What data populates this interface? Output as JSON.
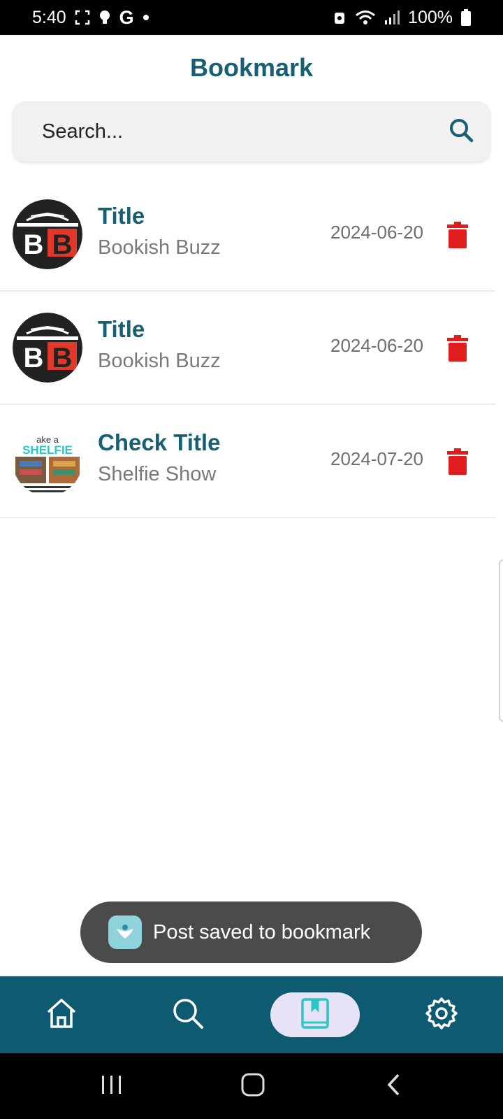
{
  "status_bar": {
    "time": "5:40",
    "icons_left": [
      "screenshot-icon",
      "lightbulb-icon",
      "google-icon",
      "dot-icon"
    ],
    "g_letter": "G",
    "battery": "100%"
  },
  "header": {
    "title": "Bookmark"
  },
  "search": {
    "placeholder": "Search...",
    "value": ""
  },
  "bookmarks": [
    {
      "title": "Title",
      "source": "Bookish Buzz",
      "date": "2024-06-20",
      "avatar": "bookish-buzz-logo",
      "logo_text": "BB"
    },
    {
      "title": "Title",
      "source": "Bookish Buzz",
      "date": "2024-06-20",
      "avatar": "bookish-buzz-logo",
      "logo_text": "BB"
    },
    {
      "title": "Check Title",
      "source": "Shelfie Show",
      "date": "2024-07-20",
      "avatar": "shelfie-show-logo",
      "logo_text": "SHELFIE"
    }
  ],
  "toast": {
    "message": "Post saved to bookmark"
  },
  "nav": {
    "items": [
      "home-icon",
      "search-icon",
      "bookmark-icon",
      "settings-icon"
    ],
    "active": "bookmark-icon"
  },
  "colors": {
    "primary": "#175f73",
    "nav_bg": "#0e5a71",
    "active_pill": "#e8e2f7",
    "delete": "#e11c1c",
    "toast_bg": "#4b4b4b"
  }
}
